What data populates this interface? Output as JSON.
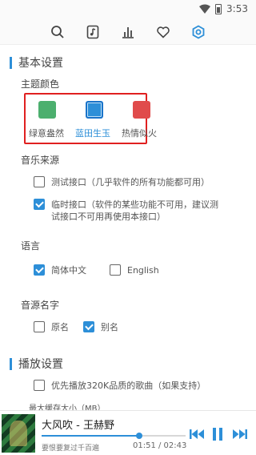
{
  "status": {
    "time": "3:53"
  },
  "toolbar": {
    "items": [
      "search-icon",
      "music-file-icon",
      "bar-chart-icon",
      "heart-icon",
      "settings-icon"
    ]
  },
  "basic": {
    "title": "基本设置",
    "theme": {
      "title": "主题颜色",
      "options": [
        {
          "label": "绿意盎然",
          "color": "#4caf6e",
          "active": false
        },
        {
          "label": "蓝田生玉",
          "color": "#2d8fd8",
          "active": true
        },
        {
          "label": "热情似火",
          "color": "#e04b4b",
          "active": false
        }
      ]
    },
    "source": {
      "title": "音乐来源",
      "options": [
        {
          "label": "测试接口（几乎软件的所有功能都可用）",
          "checked": false
        },
        {
          "label_line1": "临时接口（软件的某些功能不可用，建议测",
          "label_line2": "试接口不可用再使用本接口）",
          "checked": true
        }
      ]
    },
    "language": {
      "title": "语言",
      "options": [
        {
          "label": "简体中文",
          "checked": true
        },
        {
          "label": "English",
          "checked": false
        }
      ]
    },
    "source_name": {
      "title": "音源名字",
      "options": [
        {
          "label": "原名",
          "checked": false
        },
        {
          "label": "别名",
          "checked": true
        }
      ]
    }
  },
  "play": {
    "title": "播放设置",
    "prefer_320k": {
      "label": "优先播放320K品质的歌曲（如果支持）",
      "checked": false
    },
    "cache_label": "最大缓存大小（MB）"
  },
  "player": {
    "title": "大风吹 - 王赫野",
    "lyric": "要恨要复过千百遍",
    "time": "01:51 / 02:43",
    "progress_fraction": 0.68
  },
  "colors": {
    "accent": "#2d8fd8",
    "highlight_box": "#e02020"
  }
}
